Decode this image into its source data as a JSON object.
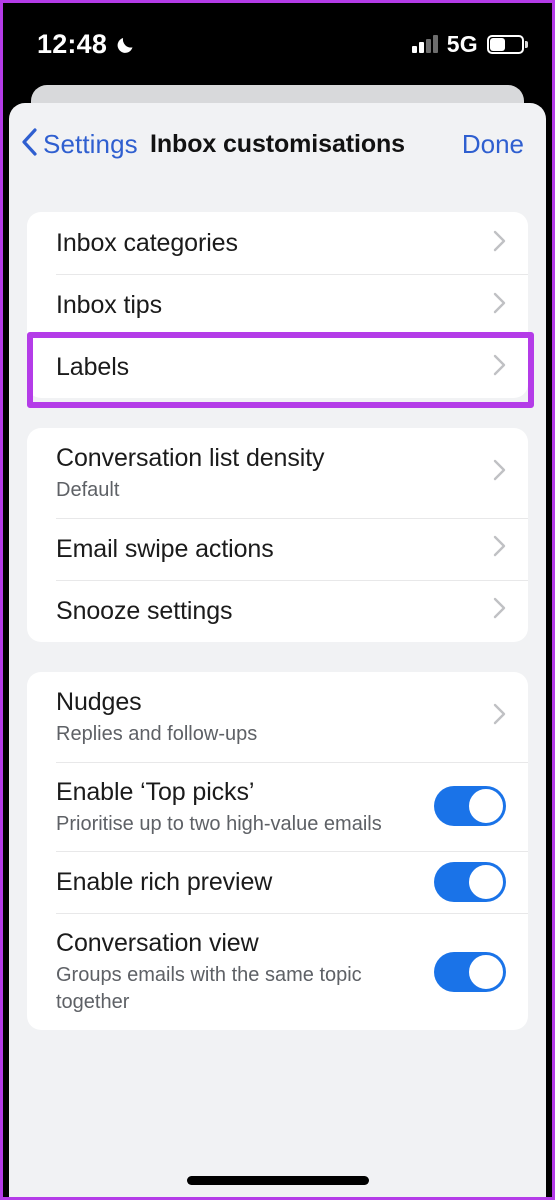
{
  "status_bar": {
    "time": "12:48",
    "dnd_icon": "crescent-moon-icon",
    "signal_icon": "cellular-signal-icon",
    "network": "5G",
    "battery_icon": "battery-icon"
  },
  "nav": {
    "back_label": "Settings",
    "back_icon": "chevron-left-icon",
    "title": "Inbox customisations",
    "done_label": "Done"
  },
  "groups": [
    {
      "rows": [
        {
          "title": "Inbox categories",
          "subtitle": "",
          "accessory": "chevron",
          "name": "inbox-categories"
        },
        {
          "title": "Inbox tips",
          "subtitle": "",
          "accessory": "chevron",
          "name": "inbox-tips"
        },
        {
          "title": "Labels",
          "subtitle": "",
          "accessory": "chevron",
          "name": "labels",
          "highlighted": true
        }
      ]
    },
    {
      "rows": [
        {
          "title": "Conversation list density",
          "subtitle": "Default",
          "accessory": "chevron",
          "name": "conversation-list-density"
        },
        {
          "title": "Email swipe actions",
          "subtitle": "",
          "accessory": "chevron",
          "name": "email-swipe-actions"
        },
        {
          "title": "Snooze settings",
          "subtitle": "",
          "accessory": "chevron",
          "name": "snooze-settings"
        }
      ]
    },
    {
      "rows": [
        {
          "title": "Nudges",
          "subtitle": "Replies and follow-ups",
          "accessory": "chevron",
          "name": "nudges"
        },
        {
          "title": "Enable ‘Top picks’",
          "subtitle": "Prioritise up to two high-value emails",
          "accessory": "toggle",
          "toggle_on": true,
          "name": "enable-top-picks"
        },
        {
          "title": "Enable rich preview",
          "subtitle": "",
          "accessory": "toggle",
          "toggle_on": true,
          "name": "enable-rich-preview"
        },
        {
          "title": "Conversation view",
          "subtitle": "Groups emails with the same topic together",
          "accessory": "toggle",
          "toggle_on": true,
          "name": "conversation-view"
        }
      ]
    }
  ],
  "annotation": {
    "color": "#b43ce8",
    "target": "Labels"
  },
  "colors": {
    "accent_blue": "#1a73e8",
    "link_blue": "#2f5fd0",
    "page_background": "#f1f2f4",
    "card_background": "#ffffff",
    "highlight_purple": "#b43ce8"
  },
  "home_indicator": "home-indicator"
}
